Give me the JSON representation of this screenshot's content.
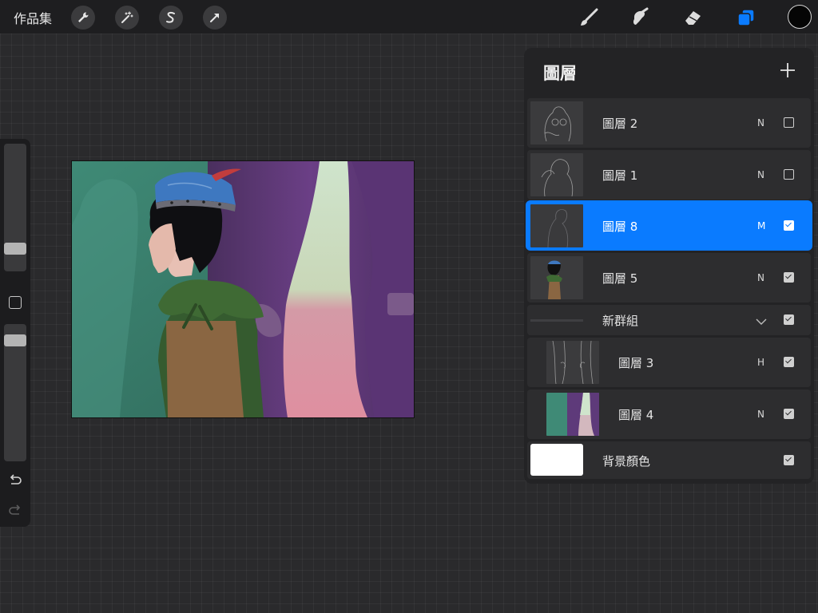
{
  "topbar": {
    "gallery_label": "作品集",
    "left_tools": [
      "wrench-icon",
      "magic-wand-icon",
      "selection-s-icon",
      "transform-arrow-icon"
    ],
    "right_tools": [
      "brush-icon",
      "smudge-icon",
      "eraser-icon",
      "layers-icon"
    ],
    "active_tool": "layers-icon",
    "current_color": "#050505"
  },
  "sidebar": {
    "brush_size_level": 0.2,
    "opacity_level": 0.95,
    "undo_icon": "undo-arrow-icon",
    "redo_icon": "redo-arrow-icon"
  },
  "layers_panel": {
    "title": "圖層",
    "add_icon": "plus-icon",
    "layers": [
      {
        "name": "圖層 2",
        "blend": "N",
        "visible": false,
        "active": false,
        "indent": false
      },
      {
        "name": "圖層 1",
        "blend": "N",
        "visible": false,
        "active": false,
        "indent": false
      },
      {
        "name": "圖層 8",
        "blend": "M",
        "visible": true,
        "active": true,
        "indent": false
      },
      {
        "name": "圖層 5",
        "blend": "N",
        "visible": true,
        "active": false,
        "indent": false
      }
    ],
    "group": {
      "name": "新群組",
      "visible": true,
      "expanded": true
    },
    "group_layers": [
      {
        "name": "圖層 3",
        "blend": "H",
        "visible": true
      },
      {
        "name": "圖層 4",
        "blend": "N",
        "visible": true
      }
    ],
    "background": {
      "name": "背景顏色",
      "color": "#ffffff",
      "visible": true
    }
  },
  "colors": {
    "accent": "#0a7bff",
    "panel": "#232325",
    "row": "#2d2d2f"
  }
}
